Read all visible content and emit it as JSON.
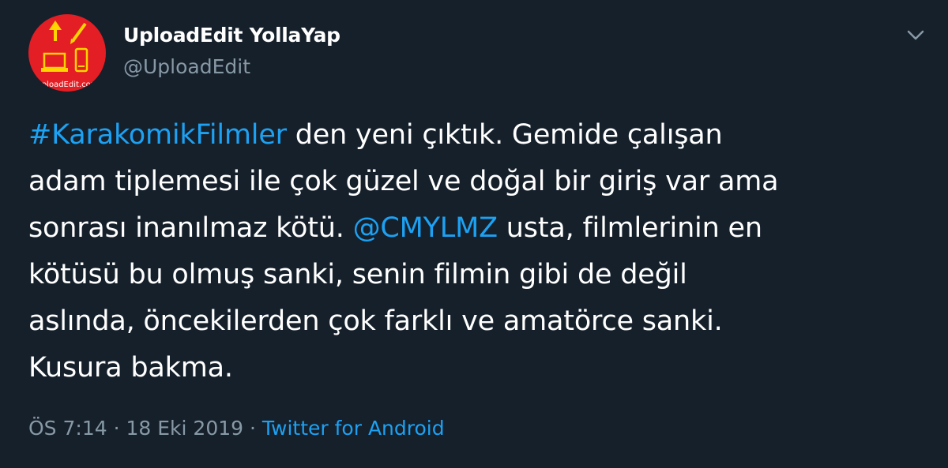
{
  "user": {
    "display_name": "UploadEdit YollaYap",
    "handle": "@UploadEdit",
    "avatar_text": "UploadEdit.com"
  },
  "tweet": {
    "lines": [
      {
        "hashtag": "#KarakomikFilmler",
        "after": " den yeni çıktık.  Gemide çalışan"
      },
      {
        "text": "adam tiplemesi ile çok güzel ve doğal bir giriş var ama"
      },
      {
        "before": "sonrası inanılmaz kötü. ",
        "mention": "@CMYLMZ",
        "after": " usta, filmlerinin en"
      },
      {
        "text": "kötüsü bu olmuş sanki, senin filmin gibi de değil"
      },
      {
        "text": "aslında, öncekilerden çok farklı ve amatörce sanki."
      },
      {
        "text": "Kusura bakma."
      }
    ]
  },
  "meta": {
    "time": "ÖS 7:14",
    "separator1": " · ",
    "date": "18 Eki 2019",
    "separator2": " · ",
    "source": "Twitter for Android"
  },
  "icons": {
    "avatar": "uploadedit-logo",
    "menu": "chevron-down-icon"
  },
  "colors": {
    "background": "#15202b",
    "link": "#1da1f2",
    "secondary": "#8899a6",
    "avatar_bg": "#e31e24",
    "avatar_icons": "#ffd400"
  }
}
